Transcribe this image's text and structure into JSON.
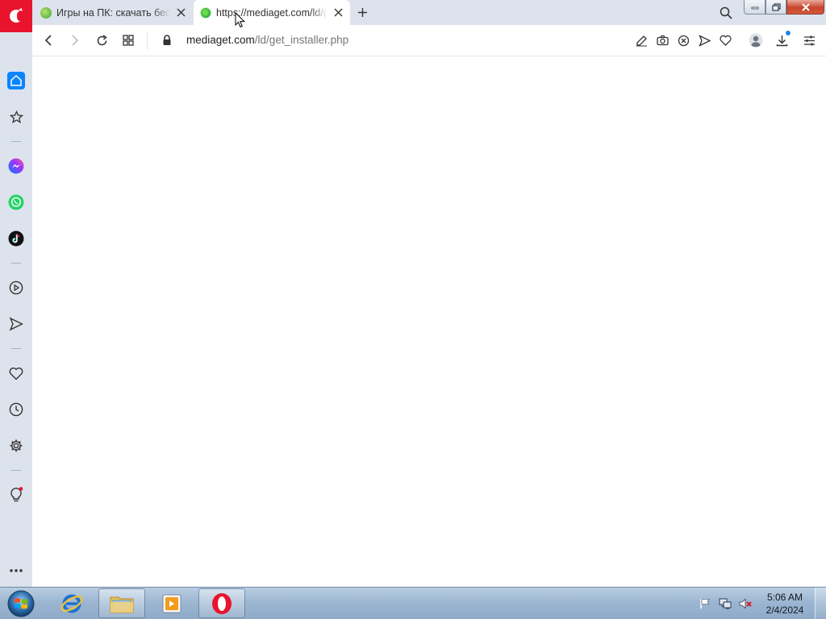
{
  "browser": {
    "tabs": [
      {
        "title": "Игры на ПК: скачать бесп",
        "favicon": "mediaget-favicon",
        "active": false
      },
      {
        "title": "https://mediaget.com/ld/g",
        "favicon": "mediaget-favicon",
        "active": true
      }
    ],
    "address": {
      "domain": "mediaget.com",
      "path": "/ld/get_installer.php"
    },
    "accent_color": "#e8142d",
    "active_indicator_color": "#0a84ff"
  },
  "sidebar": {
    "items": [
      "home",
      "bookmarks",
      "messenger",
      "whatsapp",
      "tiktok",
      "player",
      "send",
      "favorites",
      "history",
      "settings",
      "tips",
      "more"
    ]
  },
  "taskbar": {
    "apps": [
      "internet-explorer",
      "windows-explorer",
      "media-player",
      "opera"
    ],
    "clock": {
      "time": "5:06 AM",
      "date": "2/4/2024"
    }
  }
}
